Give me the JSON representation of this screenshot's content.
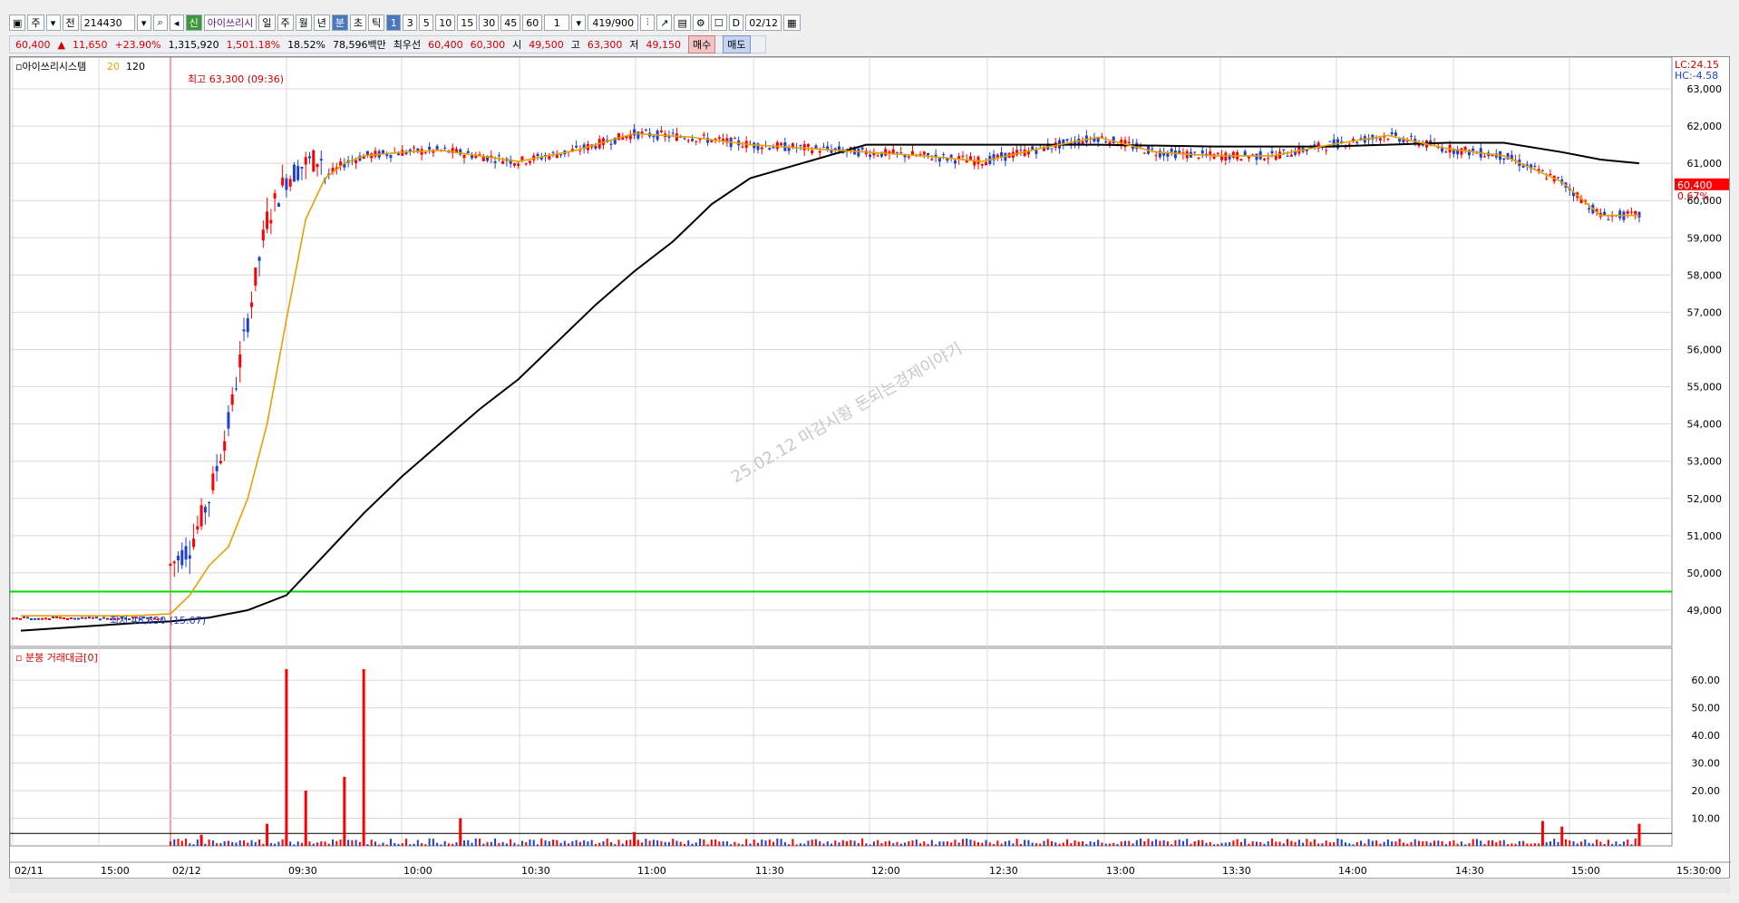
{
  "toolbar": {
    "period_label": "주",
    "prev_label": "전",
    "stock_code": "214430",
    "new_badge": "신",
    "stock_name": "아이쓰리시",
    "tf_day": "일",
    "tf_week": "주",
    "tf_month": "월",
    "tf_year": "년",
    "tf_min": "분",
    "tf_sec": "초",
    "tf_tick": "틱",
    "intervals": [
      "1",
      "3",
      "5",
      "10",
      "15",
      "30",
      "45",
      "60"
    ],
    "interval_select": "1",
    "count": "419/900",
    "date_label": "D",
    "date": "02/12"
  },
  "infobar": {
    "price": "60,400",
    "arrow": "▲",
    "change": "11,650",
    "change_pct": "+23.90%",
    "volume": "1,315,920",
    "volume_ratio": "1,501.18%",
    "turnover_pct": "18.52%",
    "trade_value": "78,596백만",
    "best_label": "최우선",
    "ask": "60,400",
    "bid": "60,300",
    "open_label": "시",
    "open": "49,500",
    "high_label": "고",
    "high": "63,300",
    "low_label": "저",
    "low": "49,150",
    "buy_label": "매수",
    "sell_label": "매도"
  },
  "price_panel": {
    "legend_name": "아이쓰리시스템",
    "ma_short": "20",
    "ma_long": "120",
    "lc_label": "LC:24.15",
    "hc_label": "HC:-4.58",
    "current_tag": "60,400",
    "current_pct": "0.67%",
    "high_annotation": "최고 63,300 (09:36)",
    "low_annotation": "최저 48,650 (15:07)",
    "watermark": "25.02.12 마감시황 돈되는경제이야기"
  },
  "volume_panel": {
    "legend": "분봉 거래대금[0]",
    "y_ticks": [
      "60.00",
      "50.00",
      "40.00",
      "30.00",
      "20.00",
      "10.00"
    ]
  },
  "colors": {
    "up": "#ff0000",
    "down": "#1f3fd0",
    "ma20": "#e8a000",
    "ma120": "#000000",
    "hline": "#00dd00",
    "grid": "#d8d8d8"
  },
  "chart_data": {
    "type": "line",
    "title": "",
    "xlabel": "",
    "ylabel": "",
    "ylim": [
      48000,
      63500
    ],
    "y_ticks": [
      49000,
      50000,
      51000,
      52000,
      53000,
      54000,
      55000,
      56000,
      57000,
      58000,
      59000,
      60000,
      61000,
      62000,
      63000
    ],
    "x_ticks": [
      "02/11",
      "15:00",
      "02/12",
      "09:30",
      "10:00",
      "10:30",
      "11:00",
      "11:30",
      "12:00",
      "12:30",
      "13:00",
      "13:30",
      "14:00",
      "14:30",
      "15:00",
      "15:30:00"
    ],
    "horizontal_line": 49500,
    "grid": true,
    "series": [
      {
        "name": "20",
        "x": [
          "02/11 14:35",
          "02/11 15:20",
          "02/12 09:00",
          "09:05",
          "09:10",
          "09:15",
          "09:20",
          "09:25",
          "09:30",
          "09:35",
          "09:40",
          "09:45",
          "09:50",
          "10:00",
          "10:10",
          "10:20",
          "10:30",
          "10:45",
          "11:00",
          "11:15",
          "11:30",
          "11:45",
          "12:00",
          "12:15",
          "12:30",
          "12:45",
          "13:00",
          "13:15",
          "13:30",
          "13:45",
          "14:00",
          "14:15",
          "14:30",
          "14:45",
          "15:00",
          "15:10",
          "15:20"
        ],
        "values": [
          48850,
          48850,
          48900,
          49400,
          50200,
          50700,
          52000,
          54000,
          56800,
          59500,
          60600,
          61000,
          61200,
          61300,
          61350,
          61200,
          61050,
          61350,
          61800,
          61700,
          61500,
          61400,
          61300,
          61200,
          61050,
          61400,
          61700,
          61300,
          61200,
          61200,
          61500,
          61750,
          61400,
          61200,
          60500,
          59600,
          59600
        ]
      },
      {
        "name": "120",
        "x": [
          "02/11 14:35",
          "02/11 15:20",
          "02/12 09:00",
          "09:10",
          "09:20",
          "09:30",
          "09:40",
          "09:50",
          "10:00",
          "10:10",
          "10:20",
          "10:30",
          "10:40",
          "10:50",
          "11:00",
          "11:10",
          "11:20",
          "11:30",
          "12:00",
          "12:30",
          "13:00",
          "13:30",
          "14:00",
          "14:30",
          "14:45",
          "15:00",
          "15:10",
          "15:20"
        ],
        "values": [
          48450,
          48650,
          48700,
          48800,
          49000,
          49400,
          50500,
          51600,
          52600,
          53500,
          54400,
          55200,
          56200,
          57200,
          58100,
          58900,
          59900,
          60600,
          61500,
          61500,
          61500,
          61450,
          61450,
          61550,
          61550,
          61300,
          61100,
          61000
        ]
      },
      {
        "name": "분봉 거래대금",
        "x": [
          "09:08",
          "09:25",
          "09:30",
          "09:35",
          "09:45",
          "09:50",
          "10:15",
          "11:00",
          "14:55",
          "15:00",
          "15:20"
        ],
        "values": [
          4,
          8,
          64,
          20,
          25,
          64,
          10,
          5,
          9,
          7,
          8
        ]
      }
    ],
    "ohlc_summary": {
      "open": 49500,
      "high": 63300,
      "low": 49150,
      "close": 60400
    }
  }
}
